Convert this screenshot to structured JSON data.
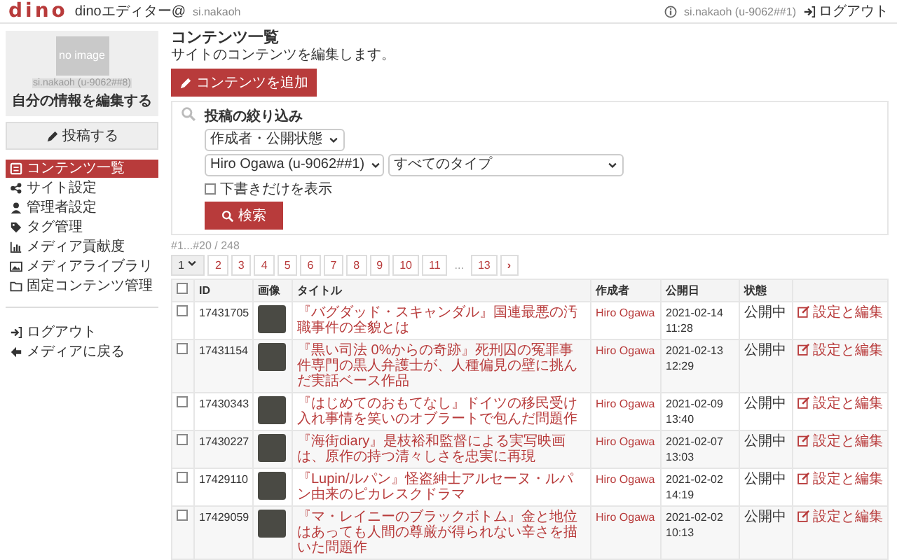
{
  "header": {
    "logo": "dino",
    "site": "dinoエディター@",
    "site_user": "si.nakaoh",
    "account": "si.nakaoh (u-9062##1)",
    "logout": "ログアウト"
  },
  "sidebar": {
    "avatar_label": "no image",
    "profile_name": "si.nakaoh (u-9062##8)",
    "profile_link": "自分の情報を編集する",
    "post_button": "投稿する",
    "items": [
      {
        "label": "コンテンツ一覧",
        "selected": true
      },
      {
        "label": "サイト設定",
        "selected": false
      },
      {
        "label": "管理者設定",
        "selected": false
      },
      {
        "label": "タグ管理",
        "selected": false
      },
      {
        "label": "メディア貢献度",
        "selected": false
      },
      {
        "label": "メディアライブラリ",
        "selected": false
      },
      {
        "label": "固定コンテンツ管理",
        "selected": false
      }
    ],
    "bottom_items": [
      "ログアウト",
      "メディアに戻る"
    ]
  },
  "main": {
    "title": "コンテンツ一覧",
    "subtitle": "サイトのコンテンツを編集します。",
    "add_button": "コンテンツを追加",
    "filter": {
      "title": "投稿の絞り込み",
      "mode_select": "作成者・公開状態",
      "author_select": "Hiro Ogawa (u-9062##1)",
      "type_select": "すべてのタイプ",
      "drafts_only": {
        "label": "下書きだけを表示",
        "checked": false
      },
      "search_button": "検索"
    },
    "count": "#1...#20 / 248",
    "pagination": {
      "current": "1",
      "pages": [
        "2",
        "3",
        "4",
        "5",
        "6",
        "7",
        "8",
        "9",
        "10",
        "11"
      ],
      "ellipsis": "...",
      "last": "13",
      "next": "›"
    },
    "table": {
      "select_all": {
        "checked": false
      },
      "columns": [
        "ID",
        "画像",
        "タイトル",
        "作成者",
        "公開日",
        "状態"
      ],
      "rows": [
        {
          "checked": false,
          "id": "17431705",
          "title": "『バグダッド・スキャンダル』国連最悪の汚職事件の全貌とは",
          "author": "Hiro Ogawa",
          "date": "2021-02-14 11:28",
          "status": "公開中",
          "action": "設定と編集"
        },
        {
          "checked": false,
          "id": "17431154",
          "title": "『黒い司法 0%からの奇跡』死刑囚の冤罪事件専門の黒人弁護士が、人種偏見の壁に挑んだ実話ベース作品",
          "author": "Hiro Ogawa",
          "date": "2021-02-13 12:29",
          "status": "公開中",
          "action": "設定と編集"
        },
        {
          "checked": false,
          "id": "17430343",
          "title": "『はじめてのおもてなし』ドイツの移民受け入れ事情を笑いのオブラートで包んだ問題作",
          "author": "Hiro Ogawa",
          "date": "2021-02-09 13:40",
          "status": "公開中",
          "action": "設定と編集"
        },
        {
          "checked": false,
          "id": "17430227",
          "title": "『海街diary』是枝裕和監督による実写映画は、原作の持つ清々しさを忠実に再現",
          "author": "Hiro Ogawa",
          "date": "2021-02-07 13:03",
          "status": "公開中",
          "action": "設定と編集"
        },
        {
          "checked": false,
          "id": "17429110",
          "title": "『Lupin/ルパン』怪盗紳士アルセーヌ・ルパン由来のピカレスクドラマ",
          "author": "Hiro Ogawa",
          "date": "2021-02-02 14:19",
          "status": "公開中",
          "action": "設定と編集"
        },
        {
          "checked": false,
          "id": "17429059",
          "title": "『マ・レイニーのブラックボトム』金と地位はあっても人間の尊厳が得られない辛さを描いた問題作",
          "author": "Hiro Ogawa",
          "date": "2021-02-02 10:13",
          "status": "公開中",
          "action": "設定と編集"
        }
      ]
    }
  }
}
